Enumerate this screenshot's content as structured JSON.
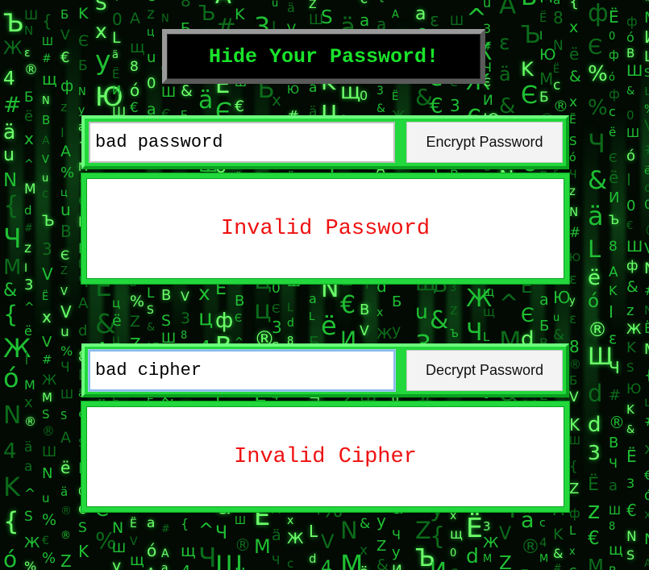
{
  "header": {
    "title": "Hide Your Password!"
  },
  "encrypt": {
    "input_value": "bad password",
    "button_label": "Encrypt Password",
    "result_text": "Invalid Password"
  },
  "decrypt": {
    "input_value": "bad cipher",
    "button_label": "Decrypt Password",
    "result_text": "Invalid Cipher"
  },
  "background": {
    "style": "matrix-code-rain",
    "glyphs": [
      "V",
      "Б",
      "#",
      "M",
      "%",
      "S",
      "a",
      "Ъ",
      "&",
      "Ю",
      "ё",
      "B",
      "Ш",
      "И",
      "®",
      "^",
      "у",
      "I",
      "d",
      "c",
      "{",
      "N",
      "4",
      "ц",
      "Ж",
      "K",
      "A",
      "x",
      "u",
      "Ë",
      "ó",
      "ε",
      "Ч",
      "0",
      "Z",
      "€",
      "ä",
      "щ",
      "Є",
      "3",
      "Ш",
      "z",
      "ф",
      "Ë",
      "L",
      "8"
    ],
    "colors": {
      "glyph_bright": "#6dff6a",
      "glyph_mid": "#1fbf33",
      "glyph_dim": "#0c6a1a",
      "background": "#020a03"
    }
  },
  "colors": {
    "accent_green": "#22d83c",
    "title_text": "#19e32a",
    "error_red": "#ee1111"
  }
}
